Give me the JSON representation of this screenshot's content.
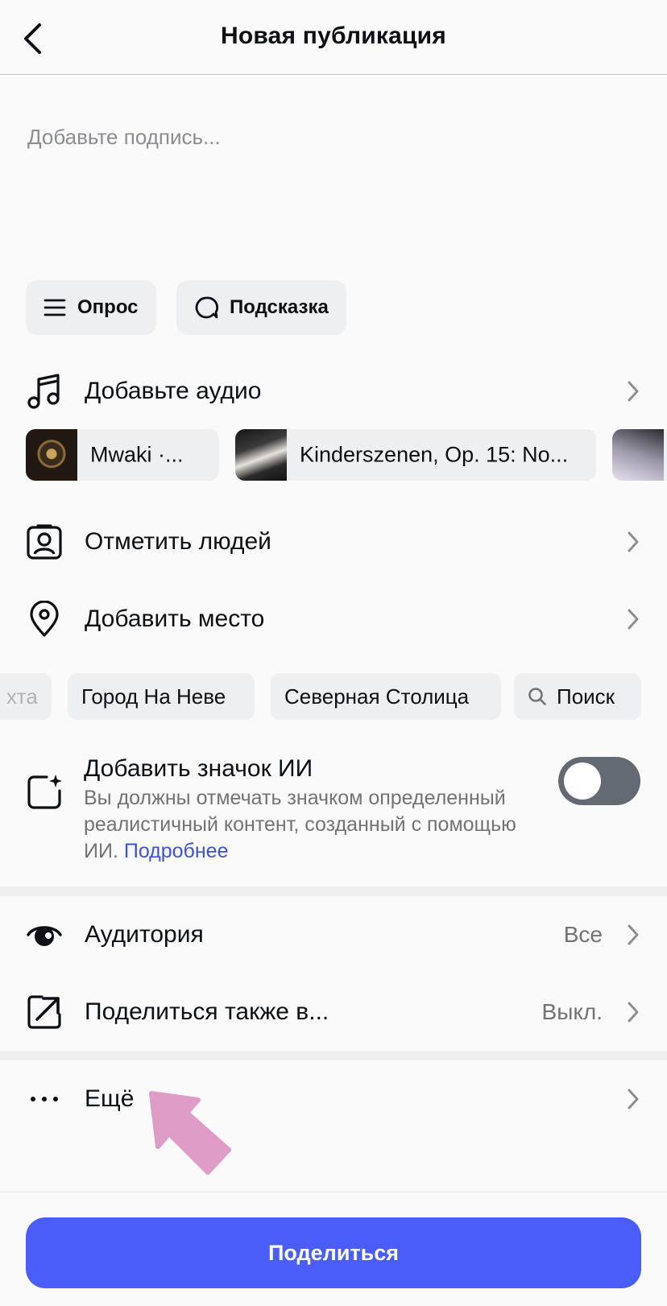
{
  "header": {
    "title": "Новая публикация"
  },
  "caption": {
    "placeholder": "Добавьте подпись..."
  },
  "chips": [
    {
      "label": "Опрос",
      "icon": "list-icon"
    },
    {
      "label": "Подсказка",
      "icon": "speech-bubble-icon"
    }
  ],
  "audio": {
    "label": "Добавьте аудио",
    "icon": "music-note-icon",
    "suggestions": [
      {
        "title": "Mwaki ·..."
      },
      {
        "title": "Kinderszenen, Op. 15: No..."
      },
      {
        "title": ""
      }
    ]
  },
  "tag_people": {
    "label": "Отметить людей",
    "icon": "tag-person-icon"
  },
  "location": {
    "label": "Добавить место",
    "icon": "location-pin-icon",
    "suggestions": [
      "хта",
      "Город На Неве",
      "Северная Столица"
    ],
    "search_label": "Поиск"
  },
  "ai_label": {
    "title": "Добавить значок ИИ",
    "description": "Вы должны отмечать значком определенный реалистичный контент, созданный с помощью ИИ.",
    "link": "Подробнее",
    "toggle_on": false,
    "icon": "sparkle-square-icon"
  },
  "audience": {
    "label": "Аудитория",
    "value": "Все",
    "icon": "eye-icon"
  },
  "share_to": {
    "label": "Поделиться также в...",
    "value": "Выкл.",
    "icon": "share-arrow-icon"
  },
  "more": {
    "label": "Ещё",
    "icon": "more-dots-icon"
  },
  "share_button": {
    "label": "Поделиться"
  },
  "colors": {
    "accent": "#4a5df9",
    "link": "#3c54d4",
    "annotation_arrow": "#df9cc6",
    "toggle_off": "#636a73"
  }
}
